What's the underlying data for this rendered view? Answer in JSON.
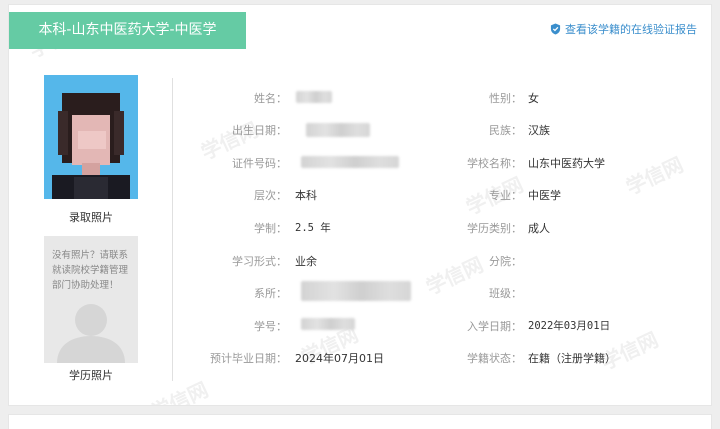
{
  "header": {
    "title": "本科-山东中医药大学-中医学",
    "verify_link": "查看该学籍的在线验证报告"
  },
  "photos": {
    "admission_caption": "录取照片",
    "education_caption": "学历照片",
    "no_photo_message": "没有照片？请联系就读院校学籍管理部门协助处理！"
  },
  "watermark": {
    "text": "学信网"
  },
  "fields": {
    "name": {
      "label": "姓名：",
      "value": ""
    },
    "gender": {
      "label": "性别：",
      "value": "女"
    },
    "birth_date": {
      "label": "出生日期：",
      "value": ""
    },
    "ethnicity": {
      "label": "民族：",
      "value": "汉族"
    },
    "id_number": {
      "label": "证件号码：",
      "value": ""
    },
    "school": {
      "label": "学校名称：",
      "value": "山东中医药大学"
    },
    "level": {
      "label": "层次：",
      "value": "本科"
    },
    "major": {
      "label": "专业：",
      "value": "中医学"
    },
    "duration": {
      "label": "学制：",
      "value": "2.5 年"
    },
    "edu_type": {
      "label": "学历类别：",
      "value": "成人"
    },
    "study_form": {
      "label": "学习形式：",
      "value": "业余"
    },
    "branch": {
      "label": "分院：",
      "value": ""
    },
    "department": {
      "label": "系所：",
      "value": ""
    },
    "class": {
      "label": "班级：",
      "value": ""
    },
    "student_id": {
      "label": "学号：",
      "value": ""
    },
    "enroll_date": {
      "label": "入学日期：",
      "value": "2022年03月01日"
    },
    "grad_date": {
      "label": "预计毕业日期：",
      "value": "2024年07月01日"
    },
    "status": {
      "label": "学籍状态：",
      "value": "在籍（注册学籍）"
    }
  },
  "colors": {
    "banner": "#65cba4",
    "link": "#3a8ecc",
    "label": "#999999",
    "value": "#333333"
  },
  "icons": {
    "verify": "shield-check-icon"
  }
}
